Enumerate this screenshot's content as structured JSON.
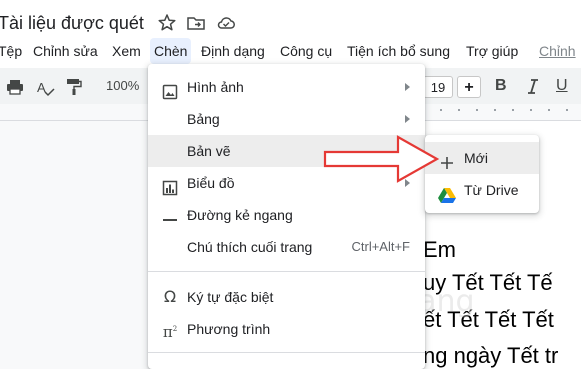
{
  "document": {
    "title": "Tài liệu được quét",
    "lines": [
      "Em",
      "uy Tết Tết Tế",
      "ết Tết Tết Tết",
      "ng ngày Tết tr"
    ]
  },
  "menubar": {
    "items": [
      "Tệp",
      "Chỉnh sửa",
      "Xem",
      "Chèn",
      "Định dạng",
      "Công cụ",
      "Tiện ích bổ sung",
      "Trợ giúp",
      "Chỉnh"
    ]
  },
  "toolbar": {
    "zoom": "100%",
    "font_size": "19",
    "plus": "+",
    "bold": "B",
    "underline": "U"
  },
  "insert_menu": {
    "items": [
      {
        "label": "Hình ảnh",
        "icon": "image-icon"
      },
      {
        "label": "Bảng",
        "icon": ""
      },
      {
        "label": "Bản vẽ",
        "icon": ""
      },
      {
        "label": "Biểu đồ",
        "icon": "chart-icon"
      },
      {
        "label": "Đường kẻ ngang",
        "icon": "horizontal-line-icon"
      },
      {
        "label": "Chú thích cuối trang",
        "shortcut": "Ctrl+Alt+F"
      },
      {
        "label": "Ký tự đặc biệt",
        "icon": "omega-icon"
      },
      {
        "label": "Phương trình",
        "icon": "pi-icon"
      }
    ]
  },
  "drawing_submenu": {
    "items": [
      {
        "label": "Mới",
        "icon": "plus-icon"
      },
      {
        "label": "Từ Drive",
        "icon": "google-drive-icon"
      }
    ]
  },
  "watermark": "uantrimang",
  "colors": {
    "accent": "#1a73e8",
    "highlight": "#ededed",
    "arrow": "#e53935",
    "menu_active": "#e8f0fe"
  }
}
